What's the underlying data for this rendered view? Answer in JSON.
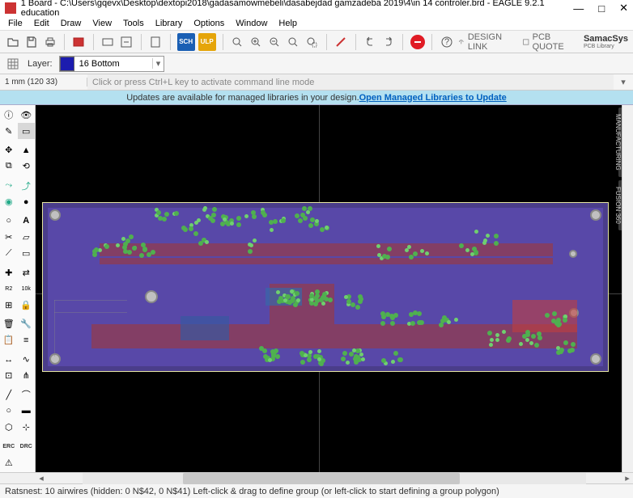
{
  "window": {
    "title": "1 Board - C:\\Users\\gqevx\\Desktop\\dextopi2018\\gadasamowmebeli\\dasabejdad gamzadeba 2019\\4\\in 14 controler.brd - EAGLE 9.2.1 education"
  },
  "menu": {
    "items": [
      "File",
      "Edit",
      "Draw",
      "View",
      "Tools",
      "Library",
      "Options",
      "Window",
      "Help"
    ]
  },
  "toolbar": {
    "sch": "SCH",
    "ulp": "ULP",
    "design_link": "DESIGN LINK",
    "pcb_quote": "PCB QUOTE",
    "brand": "SamacSys",
    "brand_sub": "PCB Library"
  },
  "layer": {
    "label": "Layer:",
    "selected": "16 Bottom",
    "color": "#1c1cae"
  },
  "coord": "1 mm (120 33)",
  "cmd_placeholder": "Click or press Ctrl+L key to activate command line mode",
  "banner": {
    "text": "Updates are available for managed libraries in your design. ",
    "link": "Open Managed Libraries to Update"
  },
  "right_tabs": {
    "manufacturing": "MANUFACTURING",
    "fusion": "FUSION 360"
  },
  "status": "Ratsnest: 10 airwires (hidden: 0 N$42, 0 N$41) Left-click & drag to define group (or left-click to start defining a group polygon)",
  "erc": "ERC",
  "drc": "DRC"
}
